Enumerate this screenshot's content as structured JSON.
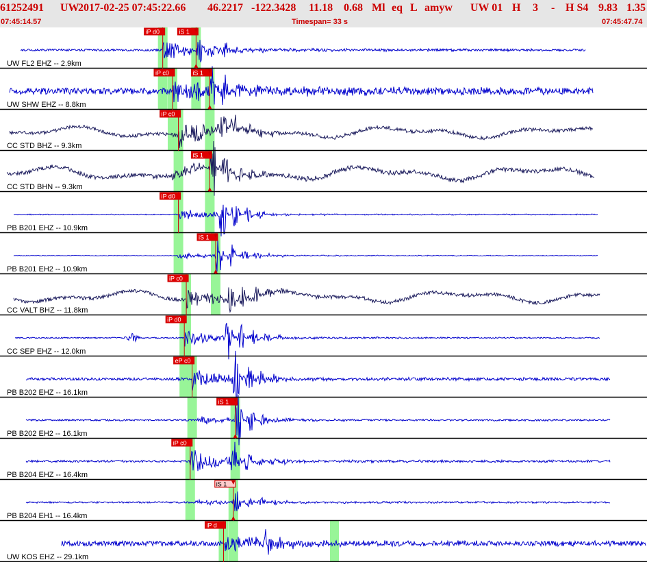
{
  "header": {
    "summary": {
      "event_id": "61252491",
      "network": "UW",
      "origin_time": "2017-02-25 07:45:22.66",
      "latitude": "46.2217",
      "longitude": "-122.3428",
      "depth": "11.18",
      "magnitude": "0.68",
      "mag_type": "Ml",
      "event_type": "eq",
      "location_flag": "L",
      "analyst": "amyw",
      "solution": "UW 01",
      "quality": "H",
      "quality_count": "3",
      "separator": "-",
      "quality2": "H S4",
      "extra1": "9.83",
      "extra2": "1.35"
    },
    "start_time": "07:45:14.57",
    "timespan": "Timespan=  33 s",
    "end_time": "07:45:47.74"
  },
  "colors": {
    "header_bg": "#e6e6e6",
    "header_text": "#cc0000",
    "trace_blue": "#0000cc",
    "trace_broadband": "#1a1a5c",
    "pick_box": "#e00000",
    "pick_box_alt": "#ffcccc",
    "pick_window": "#98f598",
    "pick_line": "#cc0000",
    "separator": "#000000"
  },
  "traces": [
    {
      "label": "UW FL2 EHZ -- 2.9km",
      "picks": [
        {
          "text": "iP d0",
          "t": 8.3
        },
        {
          "text": "iS 1",
          "t": 10.0
        }
      ]
    },
    {
      "label": "UW SHW EHZ -- 8.8km",
      "picks": [
        {
          "text": "iP c0",
          "t": 8.8
        },
        {
          "text": "iS 1",
          "t": 10.7
        }
      ]
    },
    {
      "label": "CC STD BHZ -- 9.3km",
      "picks": [
        {
          "text": "iP c0",
          "t": 9.1
        }
      ]
    },
    {
      "label": "CC STD BHN -- 9.3km",
      "picks": [
        {
          "text": "iS 1",
          "t": 10.7
        }
      ]
    },
    {
      "label": "PB B201 EHZ -- 10.9km",
      "picks": [
        {
          "text": "iP d0",
          "t": 9.1
        }
      ]
    },
    {
      "label": "PB B201 EH2 -- 10.9km",
      "picks": [
        {
          "text": "iS 1",
          "t": 11.0
        }
      ]
    },
    {
      "label": "CC VALT BHZ -- 11.8km",
      "picks": [
        {
          "text": "iP c0",
          "t": 9.5
        }
      ]
    },
    {
      "label": "CC SEP EHZ -- 12.0km",
      "picks": [
        {
          "text": "iP d0",
          "t": 9.4
        }
      ]
    },
    {
      "label": "PB B202 EHZ -- 16.1km",
      "picks": [
        {
          "text": "eP c0",
          "t": 9.8
        }
      ]
    },
    {
      "label": "PB B202 EH2 -- 16.1km",
      "picks": [
        {
          "text": "iS 1",
          "t": 12.0
        }
      ]
    },
    {
      "label": "PB B204 EHZ -- 16.4km",
      "picks": [
        {
          "text": "iP c0",
          "t": 9.7
        }
      ]
    },
    {
      "label": "PB B204 EH1 -- 16.4km",
      "picks": [
        {
          "text": "iS 1",
          "t": 11.9,
          "alt": true
        }
      ]
    },
    {
      "label": "UW KOS EHZ -- 29.1km",
      "picks": [
        {
          "text": "iP d",
          "t": 11.4
        }
      ]
    }
  ]
}
